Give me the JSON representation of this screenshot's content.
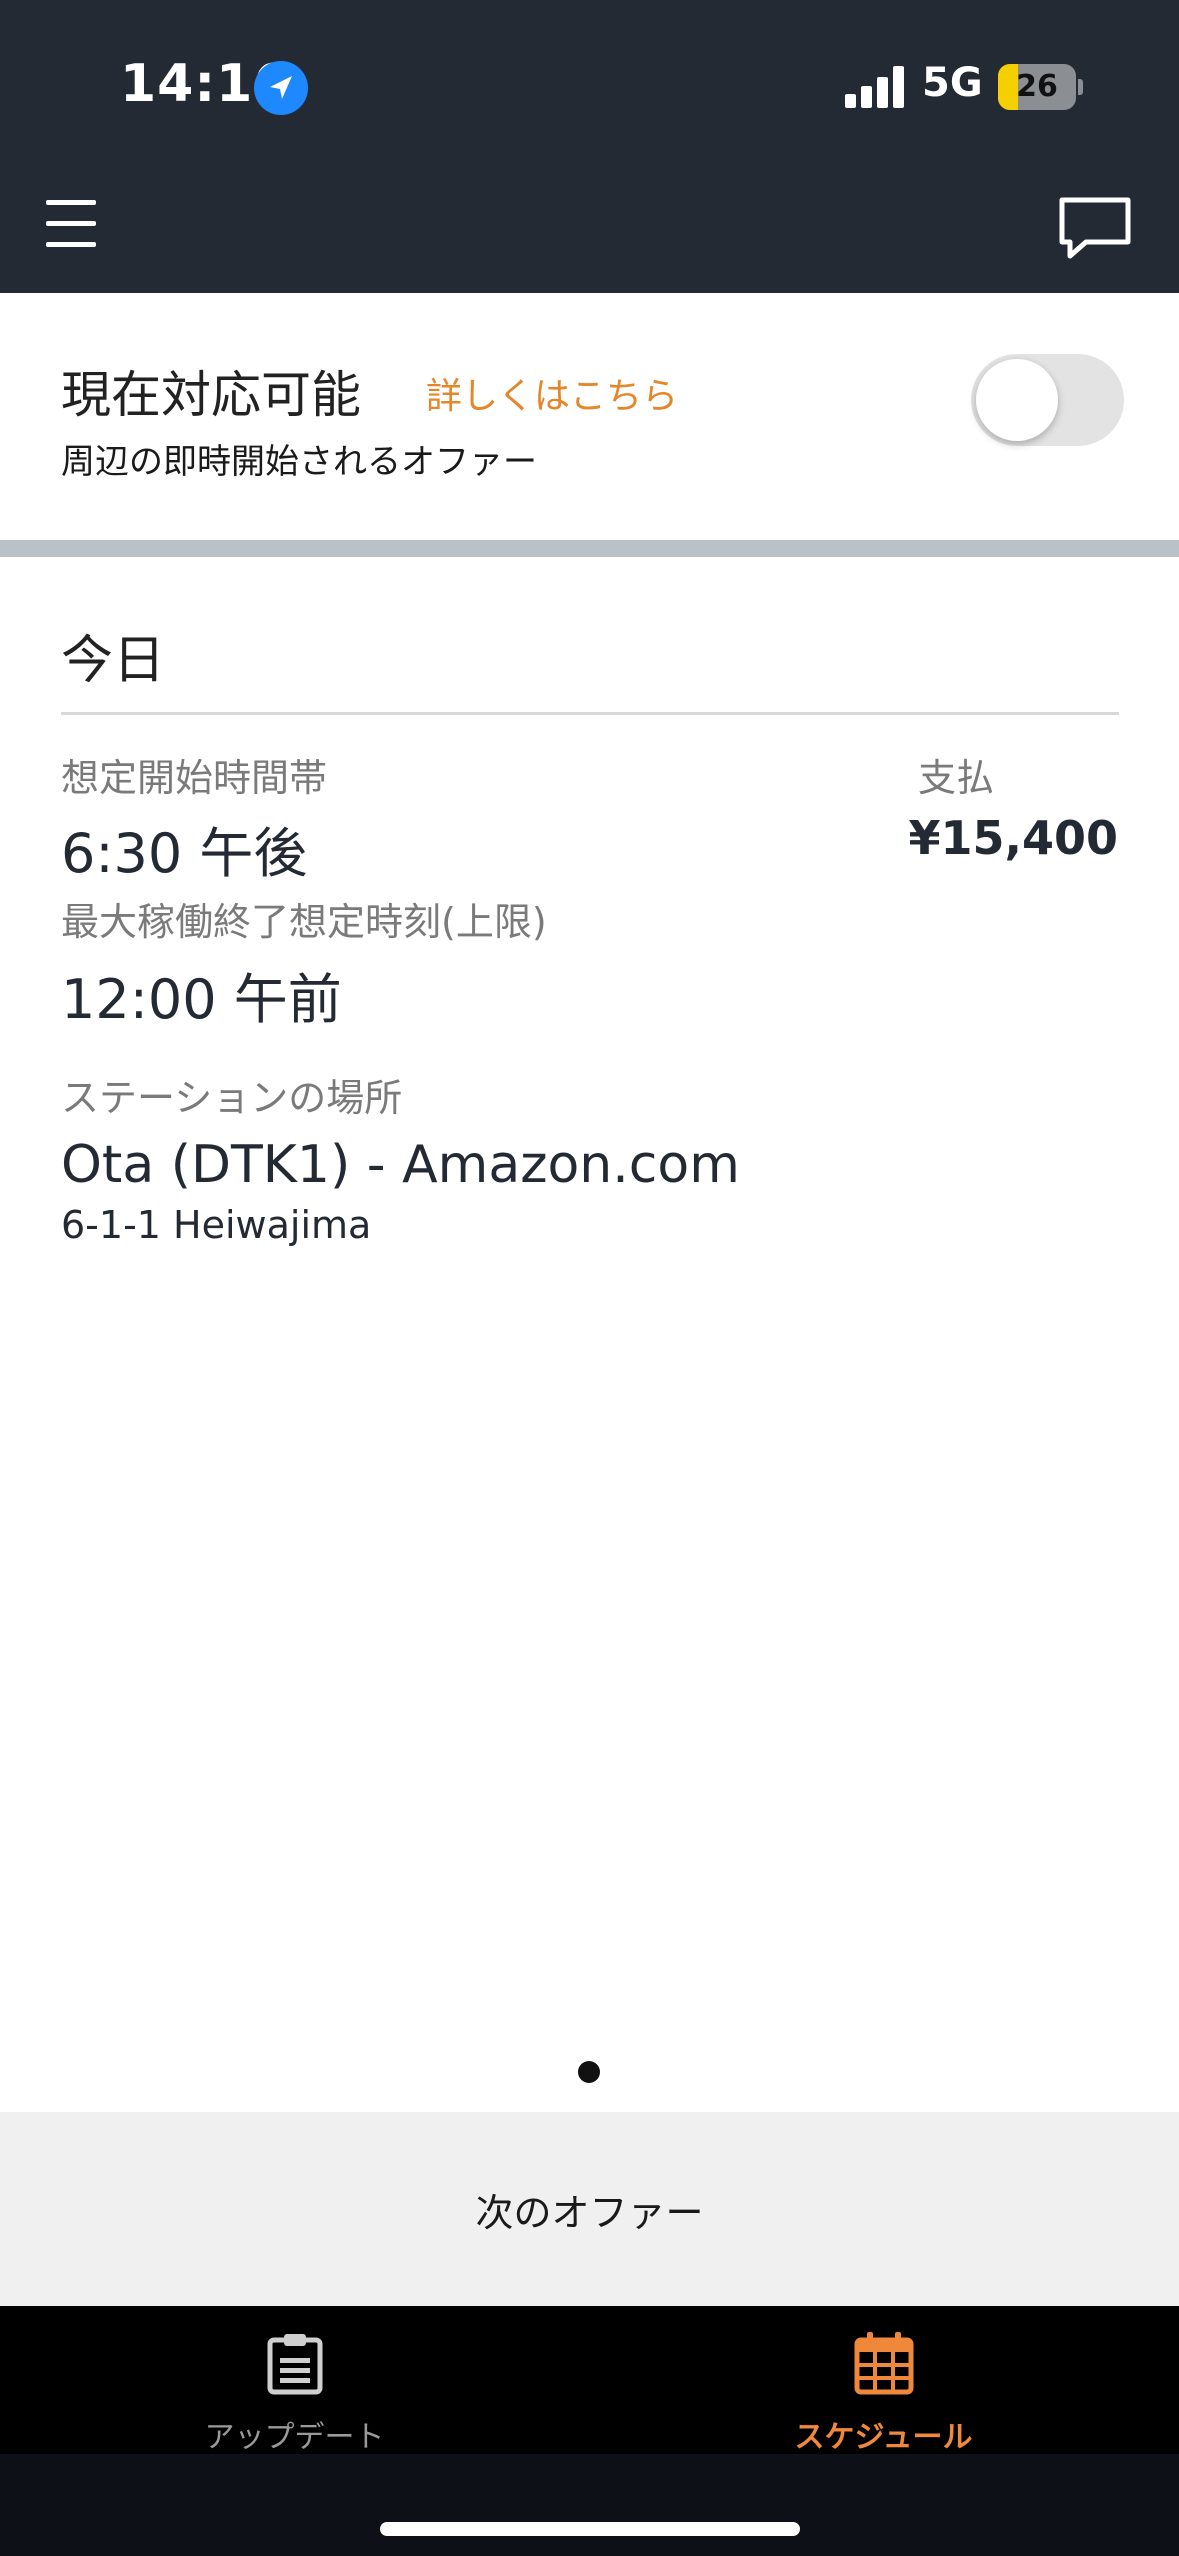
{
  "status_bar": {
    "time": "14:16",
    "network": "5G",
    "battery_level": "26",
    "battery_fraction": 0.26,
    "location_icon": "location-arrow-icon",
    "signal_icon": "cellular-signal-icon"
  },
  "header": {
    "menu_icon": "hamburger-menu-icon",
    "chat_icon": "chat-bubble-icon"
  },
  "availability": {
    "title": "現在対応可能",
    "learn_more": "詳しくはこちら",
    "subtitle": "周辺の即時開始されるオファー",
    "toggle_on": false
  },
  "offer": {
    "date_heading": "今日",
    "start_label": "想定開始時間帯",
    "start_value": "6:30 午後",
    "end_label": "最大稼働終了想定時刻(上限)",
    "end_value": "12:00 午前",
    "pay_label": "支払",
    "pay_amount": "¥15,400",
    "station_label": "ステーションの場所",
    "station_name": "Ota (DTK1) - Amazon.com",
    "station_address": "6-1-1 Heiwajima"
  },
  "pager": {
    "current": 1,
    "total": 1
  },
  "next_offer_label": "次のオファー",
  "bottom_nav": {
    "items": [
      {
        "label": "アップデート",
        "icon": "clipboard-icon",
        "active": false
      },
      {
        "label": "スケジュール",
        "icon": "calendar-icon",
        "active": true
      }
    ]
  },
  "colors": {
    "header_bg": "#232a33",
    "accent_orange": "#e6862a",
    "nav_active": "#f0883c",
    "divider": "#b9c1c9",
    "location_blue": "#1e88ff",
    "battery_yellow": "#f5d000"
  }
}
